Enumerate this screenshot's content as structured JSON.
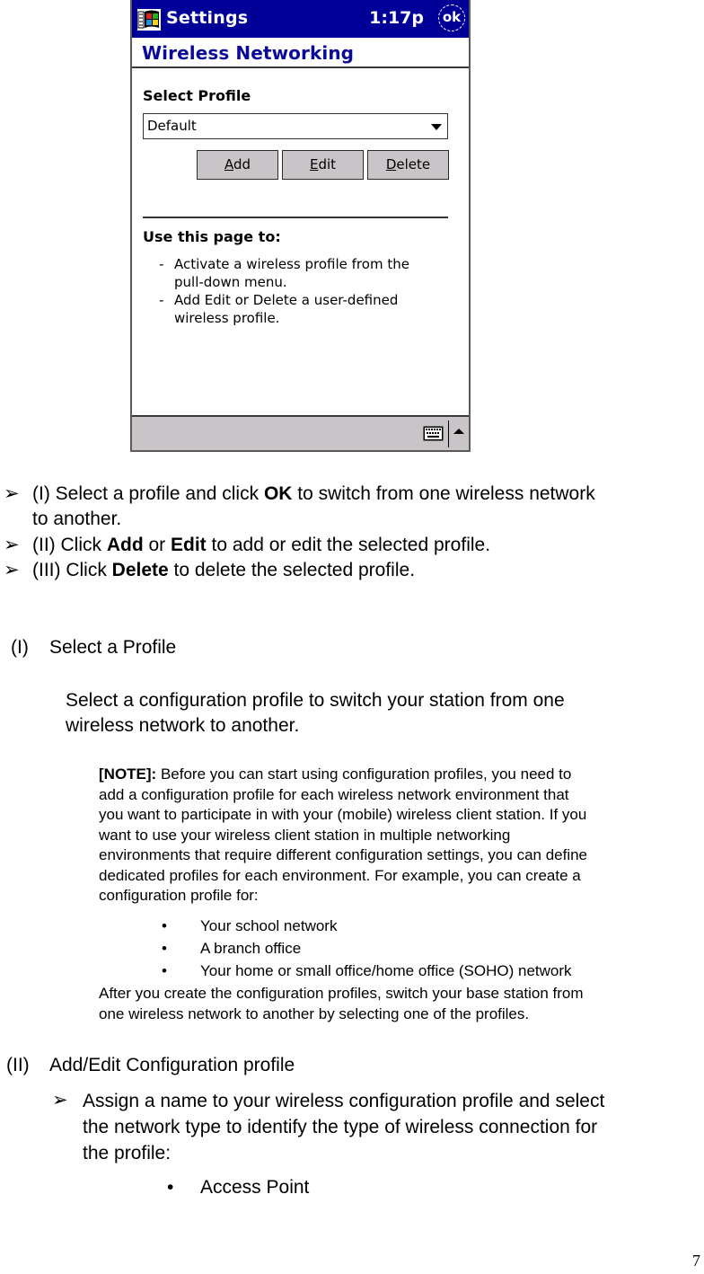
{
  "screenshot": {
    "titlebar": {
      "app_icon": "windows-start-flag-icon",
      "title": "Settings",
      "clock": "1:17p",
      "ok_label": "ok"
    },
    "page_title": "Wireless Networking",
    "select_profile_label": "Select Profile",
    "profile_dropdown": {
      "selected": "Default",
      "icon": "dropdown-arrow-icon"
    },
    "buttons": {
      "add": {
        "mnemonic": "A",
        "rest": "dd"
      },
      "edit": {
        "mnemonic": "E",
        "rest": "dit"
      },
      "delete": {
        "mnemonic": "D",
        "rest": "elete"
      }
    },
    "use_heading": "Use this page to:",
    "use_items": [
      {
        "dash": "-",
        "lines": [
          "Activate a wireless profile from the",
          "pull-down menu."
        ]
      },
      {
        "dash": "-",
        "lines": [
          "Add Edit or Delete a user-defined",
          "wireless profile."
        ]
      }
    ],
    "taskbar": {
      "keyboard_icon": "keyboard-icon",
      "sip_icon": "up-arrow-icon"
    }
  },
  "instructions": [
    {
      "pre": "(I) Select a profile and click ",
      "bold": "OK",
      "post": " to switch from one wireless network",
      "line2": "to another."
    },
    {
      "pre": "(II) Click ",
      "bold": "Add",
      "mid": " or ",
      "bold2": "Edit",
      "post": " to add or edit the selected profile."
    },
    {
      "pre": "(III) Click ",
      "bold": "Delete",
      "post": " to delete the selected profile."
    }
  ],
  "section1": {
    "number": "(I)",
    "heading": "Select a Profile",
    "body_lines": [
      "Select a configuration profile to switch your station from one",
      "wireless network to another."
    ],
    "note": {
      "label": "[NOTE]:",
      "lines": [
        " Before you can start using configuration profiles, you need to",
        "add a configuration profile for each wireless network environment that",
        "you want to participate in with your (mobile) wireless client station. If you",
        "want to use your wireless client station in multiple networking",
        "environments that require different configuration settings, you can define",
        "dedicated profiles for each environment. For example, you can create a",
        "configuration profile for:"
      ],
      "bullets": [
        "Your school network",
        "A branch office",
        "Your home or small office/home office (SOHO) network"
      ],
      "after_lines": [
        "After you create the configuration profiles, switch your base station from",
        "one wireless network to another by selecting one of the profiles."
      ]
    }
  },
  "section2": {
    "number": "(II)",
    "heading": "Add/Edit Configuration profile",
    "item_lines": [
      "Assign a name to your wireless configuration profile and select",
      "the network type to identify the type of wireless connection for",
      "the profile:"
    ],
    "bullets": [
      "Access Point"
    ]
  },
  "page_number": "7"
}
